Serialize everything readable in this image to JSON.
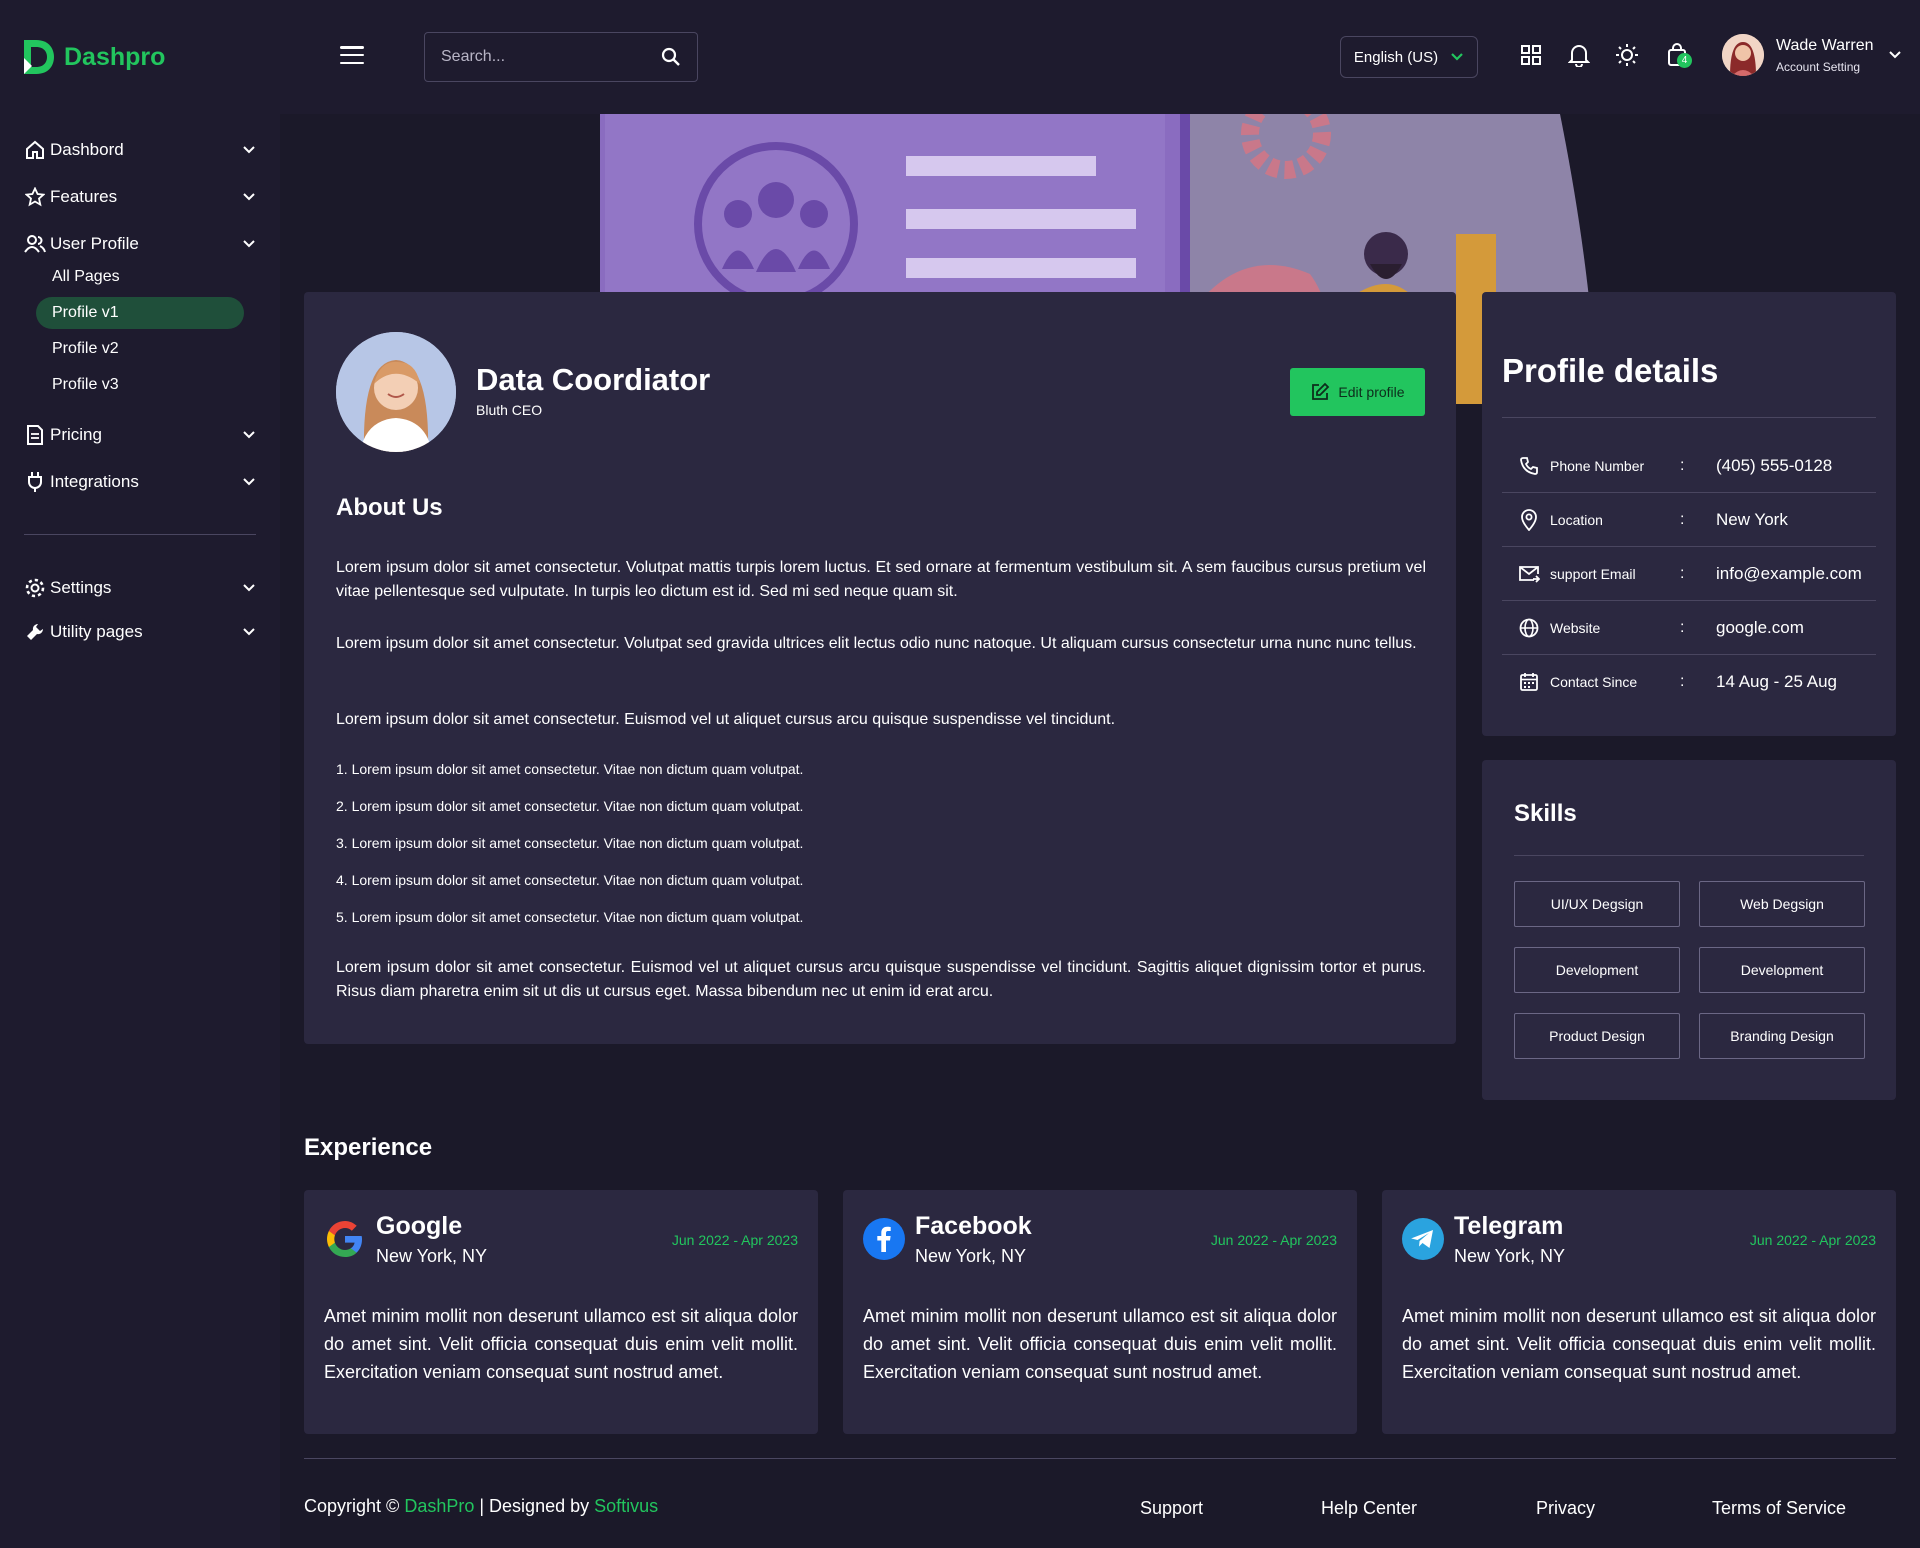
{
  "brand": {
    "name": "Dashpro"
  },
  "header": {
    "search_placeholder": "Search...",
    "language": "English (US)",
    "cart_count": "4",
    "user_name": "Wade Warren",
    "user_sub": "Account Setting"
  },
  "sidebar": {
    "items": [
      {
        "label": "Dashbord"
      },
      {
        "label": "Features"
      },
      {
        "label": "User Profile"
      },
      {
        "label": "Pricing"
      },
      {
        "label": "Integrations"
      },
      {
        "label": "Settings"
      },
      {
        "label": "Utility pages"
      }
    ],
    "sub_items": [
      {
        "label": "All Pages"
      },
      {
        "label": "Profile v1"
      },
      {
        "label": "Profile v2"
      },
      {
        "label": "Profile v3"
      }
    ]
  },
  "profile": {
    "name": "Data Coordiator",
    "role": "Bluth CEO",
    "edit_label": "Edit profile",
    "about_title": "About Us",
    "paragraphs": [
      "Lorem ipsum dolor sit amet consectetur. Volutpat mattis turpis lorem luctus. Et sed ornare at fermentum vestibulum sit. A sem faucibus cursus pretium vel vitae pellentesque sed vulputate. In turpis leo dictum est id. Sed mi sed neque quam sit.",
      "Lorem ipsum dolor sit amet consectetur. Volutpat sed gravida ultrices elit lectus odio nunc natoque. Ut aliquam cursus consectetur urna nunc nunc tellus.",
      "Lorem ipsum dolor sit amet consectetur. Euismod vel ut aliquet cursus arcu quisque suspendisse vel tincidunt.",
      "Lorem ipsum dolor sit amet consectetur. Euismod vel ut aliquet cursus arcu quisque suspendisse vel tincidunt. Sagittis aliquet dignissim tortor et purus. Risus diam pharetra enim sit ut dis ut cursus eget. Massa bibendum nec ut enim id erat arcu."
    ],
    "list": [
      "1. Lorem ipsum dolor sit amet consectetur. Vitae non dictum quam volutpat.",
      "2. Lorem ipsum dolor sit amet consectetur. Vitae non dictum quam volutpat.",
      "3. Lorem ipsum dolor sit amet consectetur. Vitae non dictum quam volutpat.",
      "4. Lorem ipsum dolor sit amet consectetur. Vitae non dictum quam volutpat.",
      "5. Lorem ipsum dolor sit amet consectetur. Vitae non dictum quam volutpat."
    ]
  },
  "details": {
    "title": "Profile details",
    "rows": [
      {
        "label": "Phone Number",
        "colon": ":",
        "value": "(405) 555-0128",
        "icon": "phone-icon"
      },
      {
        "label": "Location",
        "colon": ":",
        "value": "New York",
        "icon": "location-pin-icon"
      },
      {
        "label": "support Email",
        "colon": ":",
        "value": "info@example.com",
        "icon": "mail-icon"
      },
      {
        "label": "Website",
        "colon": ":",
        "value": "google.com",
        "icon": "globe-icon"
      },
      {
        "label": "Contact Since",
        "colon": ":",
        "value": "14 Aug - 25 Aug",
        "icon": "calendar-icon"
      }
    ]
  },
  "skills": {
    "title": "Skills",
    "items": [
      "UI/UX Degsign",
      "Web Degsign",
      "Development",
      "Development",
      "Product Design",
      "Branding Design"
    ]
  },
  "experience": {
    "title": "Experience",
    "items": [
      {
        "company": "Google",
        "location": "New York, NY",
        "dates": "Jun 2022 - Apr 2023",
        "text": "Amet minim mollit non deserunt ullamco est sit aliqua dolor do amet sint. Velit officia consequat duis enim velit mollit. Exercitation veniam consequat sunt nostrud amet."
      },
      {
        "company": "Facebook",
        "location": "New York, NY",
        "dates": "Jun 2022 - Apr 2023",
        "text": "Amet minim mollit non deserunt ullamco est sit aliqua dolor do amet sint. Velit officia consequat duis enim velit mollit. Exercitation veniam consequat sunt nostrud amet."
      },
      {
        "company": "Telegram",
        "location": "New York, NY",
        "dates": "Jun 2022 - Apr 2023",
        "text": "Amet minim mollit non deserunt ullamco est sit aliqua dolor do amet sint. Velit officia consequat duis enim velit mollit. Exercitation veniam consequat sunt nostrud amet."
      }
    ]
  },
  "footer": {
    "copyright_prefix": "Copyright ©",
    "brand": "DashPro",
    "separator": "| Designed by",
    "designer": "Softivus",
    "links": [
      "Support",
      "Help Center",
      "Privacy",
      "Terms of Service"
    ]
  },
  "colors": {
    "accent": "#22c55e",
    "background": "#1e1b2e",
    "card": "#2b2840"
  }
}
